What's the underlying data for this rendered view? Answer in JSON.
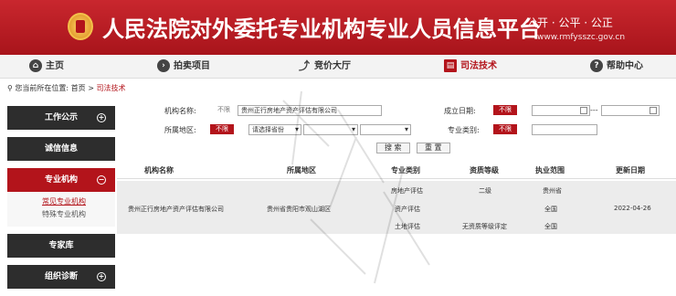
{
  "header": {
    "title": "人民法院对外委托专业机构专业人员信息平台",
    "slogan": "公开 · 公平 · 公正",
    "url": "www.rmfysszc.gov.cn"
  },
  "nav": [
    {
      "label": "主页",
      "icon": "home-icon"
    },
    {
      "label": "拍卖项目",
      "icon": "gavel-icon"
    },
    {
      "label": "竞价大厅",
      "icon": "chart-icon"
    },
    {
      "label": "司法技术",
      "icon": "book-icon"
    },
    {
      "label": "帮助中心",
      "icon": "help-icon"
    }
  ],
  "breadcrumb": {
    "prefix": "您当前所在位置:",
    "home": "首页",
    "sep": ">",
    "current": "司法技术"
  },
  "sidebar": {
    "items": [
      "工作公示",
      "诚信信息",
      "专业机构",
      "专家库",
      "组织诊断"
    ],
    "sub": [
      "常见专业机构",
      "特殊专业机构"
    ]
  },
  "form": {
    "org_name_label": "机构名称:",
    "unlimited": "不限",
    "org_name_value": "贵州正行房地产资产评估有限公司",
    "region_label": "所属地区:",
    "province_placeholder": "请选择省份",
    "founded_label": "成立日期:",
    "date_sep": "---",
    "type_label": "专业类别:",
    "search_btn": "搜 索",
    "reset_btn": "重 置"
  },
  "table": {
    "headers": [
      "机构名称",
      "所属地区",
      "专业类别",
      "资质等级",
      "执业范围",
      "更新日期"
    ],
    "row": {
      "name": "贵州正行房地产资产评估有限公司",
      "region": "贵州省贵阳市观山湖区",
      "types": [
        "房地产评估",
        "资产评估",
        "土地评估"
      ],
      "grades": [
        "二级",
        "",
        "无资质等级评定"
      ],
      "scopes": [
        "贵州省",
        "全国",
        "全国"
      ],
      "updated": "2022-04-26"
    }
  },
  "colors": {
    "brand": "#b3141b",
    "dark": "#2d2d2d"
  }
}
